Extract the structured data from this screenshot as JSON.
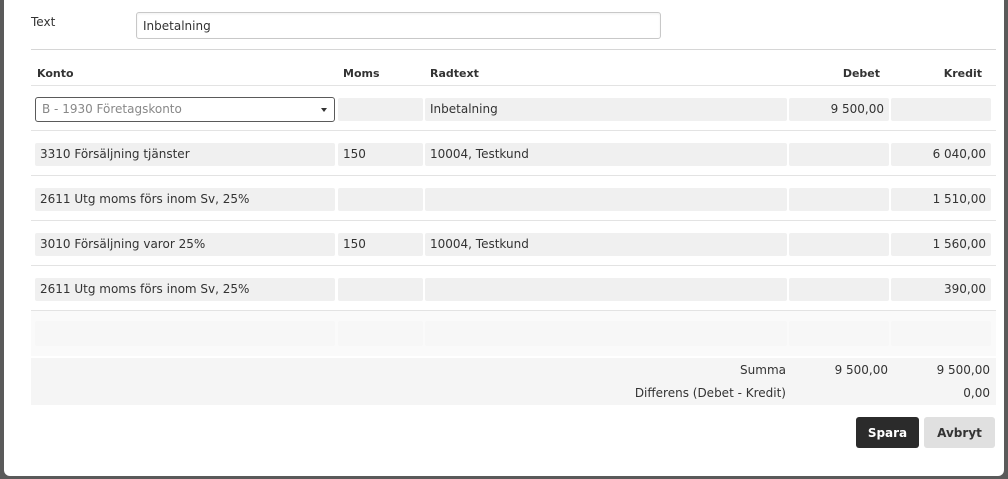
{
  "form": {
    "text_label": "Text",
    "text_value": "Inbetalning"
  },
  "grid": {
    "columns": {
      "konto": "Konto",
      "moms": "Moms",
      "radtext": "Radtext",
      "debet": "Debet",
      "kredit": "Kredit"
    },
    "first_row": {
      "konto_selected": "B - 1930 Företagskonto",
      "moms": "",
      "radtext": "Inbetalning",
      "debet": "9 500,00",
      "kredit": ""
    },
    "rows": [
      {
        "konto": "3310 Försäljning tjänster",
        "moms": "150",
        "radtext": "10004, Testkund",
        "debet": "",
        "kredit": "6 040,00"
      },
      {
        "konto": "2611 Utg moms förs inom Sv, 25%",
        "moms": "",
        "radtext": "",
        "debet": "",
        "kredit": "1 510,00"
      },
      {
        "konto": "3010 Försäljning varor 25%",
        "moms": "150",
        "radtext": "10004, Testkund",
        "debet": "",
        "kredit": "1 560,00"
      },
      {
        "konto": "2611 Utg moms förs inom Sv, 25%",
        "moms": "",
        "radtext": "",
        "debet": "",
        "kredit": "390,00"
      }
    ]
  },
  "summary": {
    "summa_label": "Summa",
    "summa_debet": "9 500,00",
    "summa_kredit": "9 500,00",
    "diff_label": "Differens (Debet - Kredit)",
    "diff_value": "0,00"
  },
  "actions": {
    "save_label": "Spara",
    "cancel_label": "Avbryt"
  }
}
